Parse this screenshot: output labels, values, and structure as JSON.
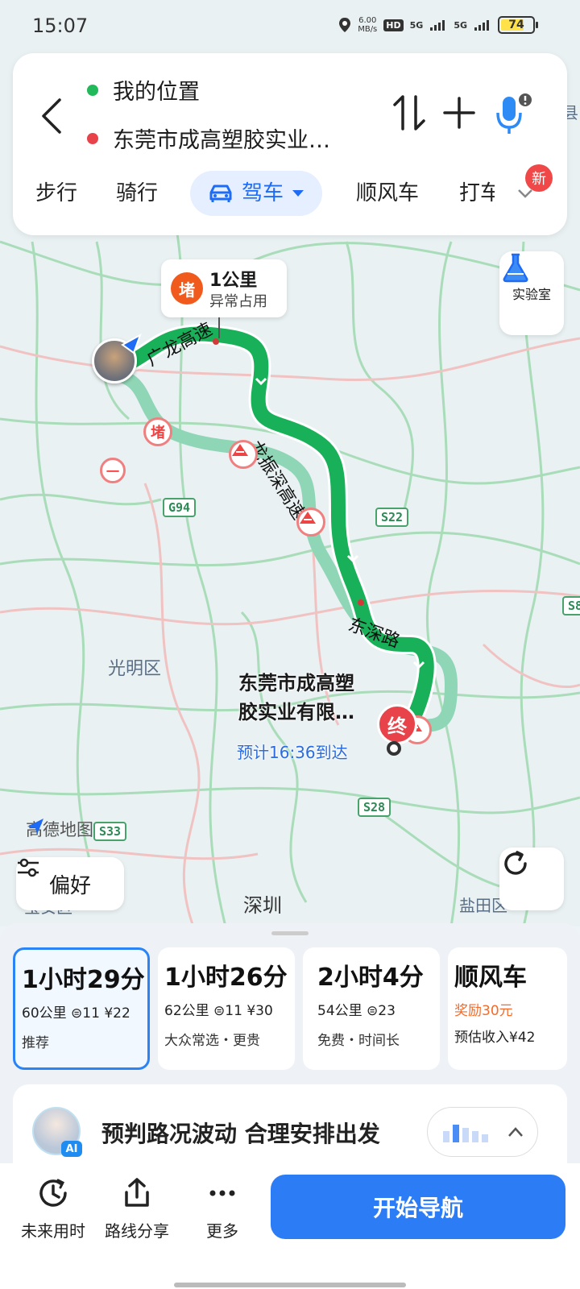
{
  "status_bar": {
    "time": "15:07",
    "net_speed_value": "6.00",
    "net_speed_unit": "MB/s",
    "hd": "HD",
    "signal1": "5G",
    "signal2": "5G",
    "battery": "74",
    "battery_level": 0.74
  },
  "route_input": {
    "origin": "我的位置",
    "destination": "东莞市成高塑胶实业…",
    "origin_color": "#22b95a",
    "destination_color": "#e8434b"
  },
  "modes": {
    "walk": "步行",
    "bike": "骑行",
    "drive": "驾车",
    "carpool": "顺风车",
    "taxi": "打车",
    "new_badge": "新"
  },
  "map": {
    "jam_badge": "堵",
    "jam_distance": "1公里",
    "jam_desc": "异常占用",
    "lab_label": "实验室",
    "road_labels": {
      "guanglong": "广龙高速",
      "longzhen": "龙振深高速",
      "dongshen": "东深路"
    },
    "district": "光明区",
    "district_bottom_left": "宝安区",
    "district_bottom_mid": "深圳",
    "district_bottom_right": "盐田区",
    "shields": {
      "g94": "G94",
      "s22": "S22",
      "s28": "S28",
      "s33": "S33",
      "s_edge": "S8"
    },
    "jam_marker": "堵",
    "no_entry_marker": "一",
    "destination_line1": "东莞市成高塑",
    "destination_line2": "胶实业有限…",
    "eta": "预计16:36到达",
    "end_marker": "终",
    "logo": "高德地图",
    "preference": "偏好",
    "edge_char": "县"
  },
  "routes": [
    {
      "time": "1小时29分",
      "distance": "60公里",
      "lights": "11",
      "fee": "¥22",
      "tag": "推荐",
      "selected": true
    },
    {
      "time": "1小时26分",
      "distance": "62公里",
      "lights": "11",
      "fee": "¥30",
      "tag": "大众常选・更贵",
      "selected": false
    },
    {
      "time": "2小时4分",
      "distance": "54公里",
      "lights": "23",
      "fee": "",
      "tag": "免费・时间长",
      "selected": false
    },
    {
      "time": "顺风车",
      "reward": "奖励30元",
      "income": "预估收入¥42"
    }
  ],
  "ai": {
    "badge": "AI",
    "message": "预判路况波动 合理安排出发"
  },
  "bottom_bar": {
    "future_time": "未来用时",
    "share_route": "路线分享",
    "more": "更多",
    "start_nav": "开始导航"
  },
  "colors": {
    "accent": "#2c7cf6",
    "route_green": "#18b15a",
    "route_alt": "#8fd6b6",
    "jam_orange": "#f15a1d"
  }
}
